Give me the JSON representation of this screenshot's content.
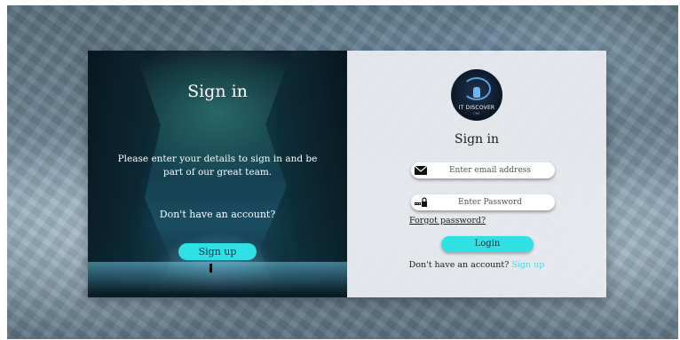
{
  "left": {
    "title": "Sign in",
    "description": "Please enter your details to sign in and be part of our great team.",
    "no_account": "Don't have an account?",
    "signup_label": "Sign up"
  },
  "right": {
    "logo_text": "IT DISCOVER",
    "logo_sub": "CHE",
    "title": "Sign in",
    "email_placeholder": "Enter email address",
    "password_placeholder": "Enter Password",
    "forgot_label": "Forgot password?",
    "login_label": "Login",
    "no_account": "Don't have an account?",
    "signup_link": "Sign up"
  },
  "icons": {
    "email": "envelope-icon",
    "password": "key-lock-icon"
  },
  "colors": {
    "accent": "#2ee1e4",
    "link": "#57d3df",
    "panel": "#eceef2"
  }
}
